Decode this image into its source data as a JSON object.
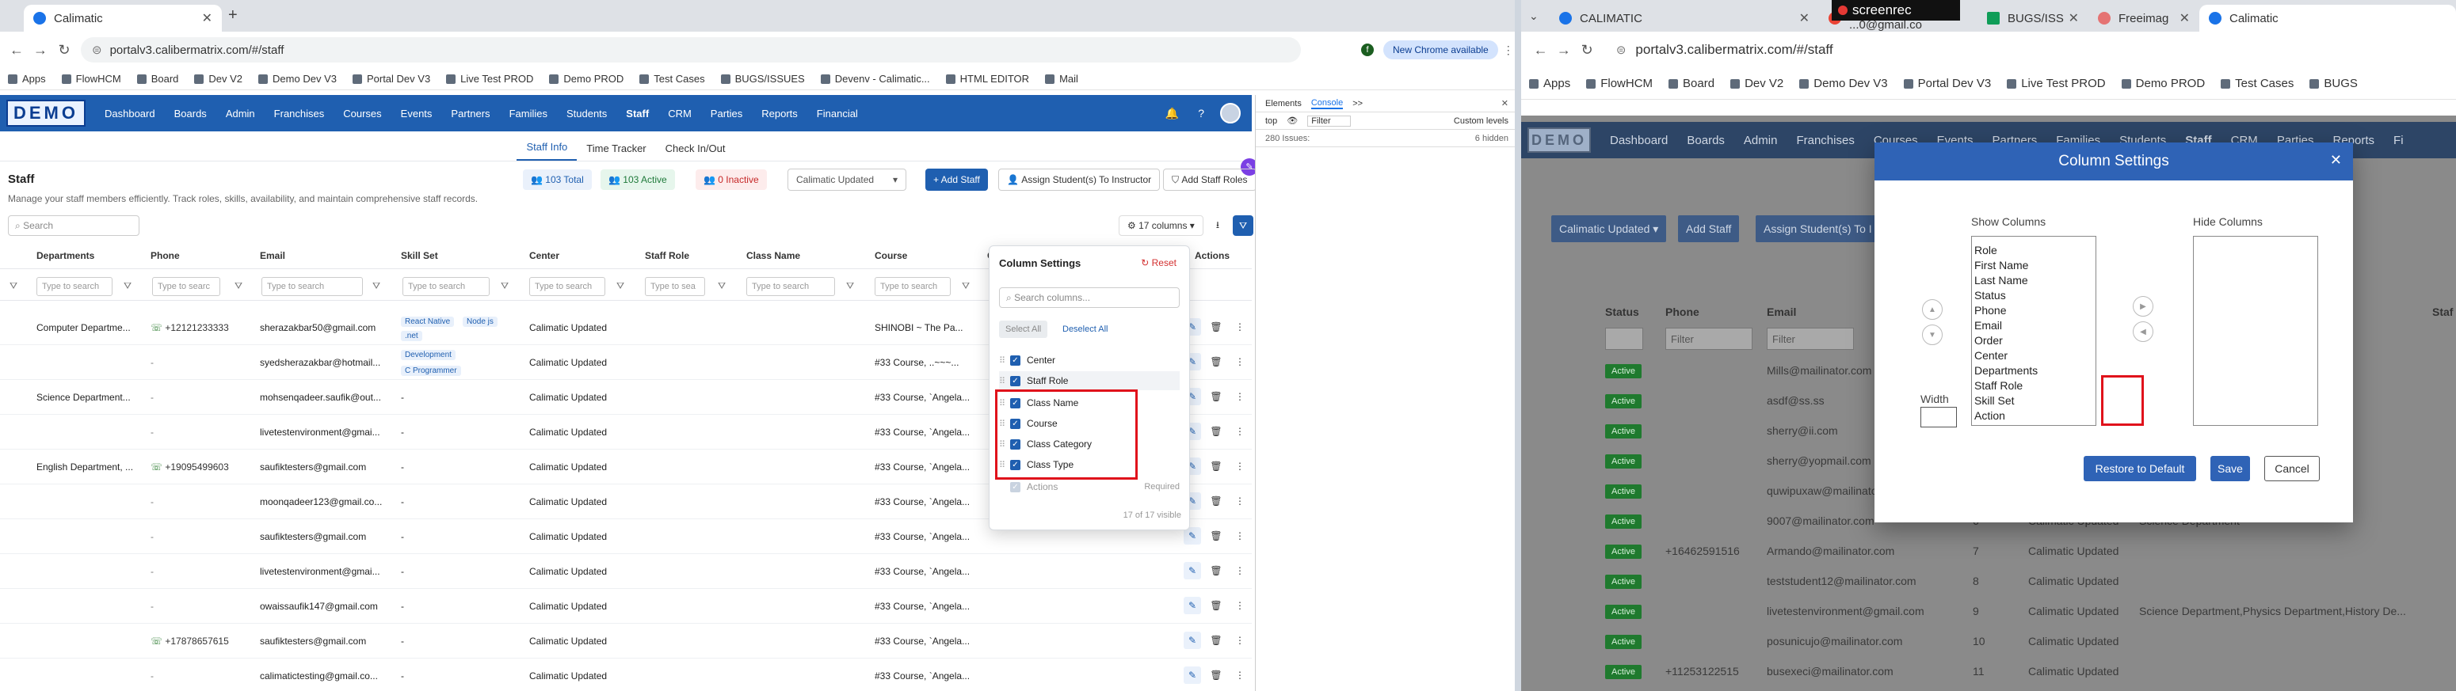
{
  "left_browser": {
    "tab_title": "Calimatic",
    "url": "portalv3.calibermatrix.com/#/staff",
    "new_chrome": "New Chrome available",
    "avatar_letter": "f",
    "bookmarks": [
      "Apps",
      "FlowHCM",
      "Board",
      "Dev V2",
      "Demo Dev V3",
      "Portal Dev V3",
      "Live Test PROD",
      "Demo PROD",
      "Test Cases",
      "BUGS/ISSUES",
      "Devenv - Calimatic...",
      "HTML EDITOR",
      "Mail"
    ]
  },
  "app": {
    "logo": "DEMO",
    "nav": [
      "Dashboard",
      "Boards",
      "Admin",
      "Franchises",
      "Courses",
      "Events",
      "Partners",
      "Families",
      "Students",
      "Staff",
      "CRM",
      "Parties",
      "Reports",
      "Financial"
    ],
    "subtabs": [
      "Staff Info",
      "Time Tracker",
      "Check In/Out"
    ],
    "title": "Staff",
    "description": "Manage your staff members efficiently. Track roles, skills, availability, and maintain comprehensive staff records.",
    "stats": {
      "total": "103 Total",
      "active": "103 Active",
      "inactive": "0 Inactive"
    },
    "franchise_select": "Calimatic Updated",
    "buttons": {
      "add_staff": "+ Add Staff",
      "assign": "Assign Student(s) To Instructor",
      "add_roles": "Add Staff Roles"
    },
    "search_placeholder": "Search",
    "columns_count": "17 columns",
    "headers": [
      "Departments",
      "Phone",
      "Email",
      "Skill Set",
      "Center",
      "Staff Role",
      "Class Name",
      "Course",
      "Cl",
      "Actions"
    ],
    "filter_placeholders": [
      "Type to search",
      "Type to searc",
      "Type to search",
      "Type to search",
      "Type to search",
      "Type to sea",
      "Type to search",
      "Type to search"
    ],
    "rows": [
      {
        "dept": "Computer Departme...",
        "phone": "+12121233333",
        "email": "sherazakbar50@gmail.com",
        "skills": [
          "React Native",
          "Node js",
          ".net"
        ],
        "center": "Calimatic Updated",
        "course": "SHINOBI ~ The Pa..."
      },
      {
        "dept": "",
        "phone": "-",
        "email": "syedsherazakbar@hotmail...",
        "skills": [
          "Development",
          "C Programmer"
        ],
        "center": "Calimatic Updated",
        "course": "#33 Course, ..~~~..."
      },
      {
        "dept": "Science Department...",
        "phone": "-",
        "email": "mohsenqadeer.saufik@out...",
        "skills": [
          "-"
        ],
        "center": "Calimatic Updated",
        "course": "#33 Course, `Angela..."
      },
      {
        "dept": "",
        "phone": "-",
        "email": "livetestenvironment@gmai...",
        "skills": [
          "-"
        ],
        "center": "Calimatic Updated",
        "course": "#33 Course, `Angela..."
      },
      {
        "dept": "English Department, ...",
        "phone": "+19095499603",
        "email": "saufiktesters@gmail.com",
        "skills": [
          "-"
        ],
        "center": "Calimatic Updated",
        "course": "#33 Course, `Angela..."
      },
      {
        "dept": "",
        "phone": "-",
        "email": "moonqadeer123@gmail.co...",
        "skills": [
          "-"
        ],
        "center": "Calimatic Updated",
        "course": "#33 Course, `Angela..."
      },
      {
        "dept": "",
        "phone": "-",
        "email": "saufiktesters@gmail.com",
        "skills": [
          "-"
        ],
        "center": "Calimatic Updated",
        "course": "#33 Course, `Angela..."
      },
      {
        "dept": "",
        "phone": "-",
        "email": "livetestenvironment@gmai...",
        "skills": [
          "-"
        ],
        "center": "Calimatic Updated",
        "course": "#33 Course, `Angela..."
      },
      {
        "dept": "",
        "phone": "-",
        "email": "owaissaufik147@gmail.com",
        "skills": [
          "-"
        ],
        "center": "Calimatic Updated",
        "course": "#33 Course, `Angela..."
      },
      {
        "dept": "",
        "phone": "+17878657615",
        "email": "saufiktesters@gmail.com",
        "skills": [
          "-"
        ],
        "center": "Calimatic Updated",
        "course": "#33 Course, `Angela..."
      },
      {
        "dept": "",
        "phone": "-",
        "email": "calimatictesting@gmail.co...",
        "skills": [
          "-"
        ],
        "center": "Calimatic Updated",
        "course": "#33 Course, `Angela..."
      }
    ],
    "column_settings": {
      "title": "Column Settings",
      "reset": "Reset",
      "search_placeholder": "Search columns...",
      "select_all": "Select All",
      "deselect_all": "Deselect All",
      "items": [
        "Center",
        "Staff Role",
        "Class Name",
        "Course",
        "Class Category",
        "Class Type"
      ],
      "actions_label": "Actions",
      "required": "Required",
      "footer": "17 of 17 visible"
    }
  },
  "devtools": {
    "tabs": [
      "Elements",
      "Console",
      ">>"
    ],
    "top": "top",
    "filter": "Filter",
    "levels": "Custom levels",
    "issues": "280 Issues:",
    "hidden": "6 hidden"
  },
  "right_browser": {
    "tabs": [
      "CALIMATIC",
      "Archive - ...0@gmail.co",
      "BUGS/ISS",
      "Freeimag",
      "Calimatic"
    ],
    "screenrec": "screenrec",
    "url": "portalv3.calibermatrix.com/#/staff",
    "bookmarks": [
      "Apps",
      "FlowHCM",
      "Board",
      "Dev V2",
      "Demo Dev V3",
      "Portal Dev V3",
      "Live Test PROD",
      "Demo PROD",
      "Test Cases",
      "BUGS"
    ],
    "nav": [
      "Dashboard",
      "Boards",
      "Admin",
      "Franchises",
      "Courses",
      "Events",
      "Partners",
      "Families",
      "Students",
      "Staff",
      "CRM",
      "Parties",
      "Reports",
      "Fi"
    ],
    "buttons": [
      "Calimatic Updated ▾",
      "Add Staff",
      "Assign Student(s) To I"
    ],
    "headers": [
      "Status",
      "Phone",
      "Email",
      "Staf"
    ],
    "filter_placeholders": [
      "Filter",
      "Filter"
    ],
    "rows": [
      {
        "status": "Active",
        "phone": "",
        "email": "Mills@mailinator.com",
        "order": "",
        "center": "",
        "dept": ""
      },
      {
        "status": "Active",
        "phone": "",
        "email": "asdf@ss.ss",
        "order": "",
        "center": "",
        "dept": ""
      },
      {
        "status": "Active",
        "phone": "",
        "email": "sherry@ii.com",
        "order": "",
        "center": "",
        "dept": ""
      },
      {
        "status": "Active",
        "phone": "",
        "email": "sherry@yopmail.com",
        "order": "",
        "center": "",
        "dept": ""
      },
      {
        "status": "Active",
        "phone": "",
        "email": "quwipuxaw@mailinator.com",
        "order": "",
        "center": "",
        "dept": ""
      },
      {
        "status": "Active",
        "phone": "",
        "email": "9007@mailinator.com",
        "order": "6",
        "center": "Calimatic Updated",
        "dept": "Science Department"
      },
      {
        "status": "Active",
        "phone": "+16462591516",
        "email": "Armando@mailinator.com",
        "order": "7",
        "center": "Calimatic Updated",
        "dept": ""
      },
      {
        "status": "Active",
        "phone": "",
        "email": "teststudent12@mailinator.com",
        "order": "8",
        "center": "Calimatic Updated",
        "dept": ""
      },
      {
        "status": "Active",
        "phone": "",
        "email": "livetestenvironment@gmail.com",
        "order": "9",
        "center": "Calimatic Updated",
        "dept": "Science Department,Physics Department,History De..."
      },
      {
        "status": "Active",
        "phone": "",
        "email": "posunicujo@mailinator.com",
        "order": "10",
        "center": "Calimatic Updated",
        "dept": ""
      },
      {
        "status": "Active",
        "phone": "+11253122515",
        "email": "busexeci@mailinator.com",
        "order": "11",
        "center": "Calimatic Updated",
        "dept": ""
      }
    ],
    "modal": {
      "title": "Column Settings",
      "show_label": "Show Columns",
      "hide_label": "Hide Columns",
      "width_label": "Width",
      "show_items": [
        "Role",
        "First Name",
        "Last Name",
        "Status",
        "Phone",
        "Email",
        "Order",
        "Center",
        "Departments",
        "Staff Role",
        "Skill Set",
        "Action"
      ],
      "restore": "Restore to Default",
      "save": "Save",
      "cancel": "Cancel"
    }
  }
}
